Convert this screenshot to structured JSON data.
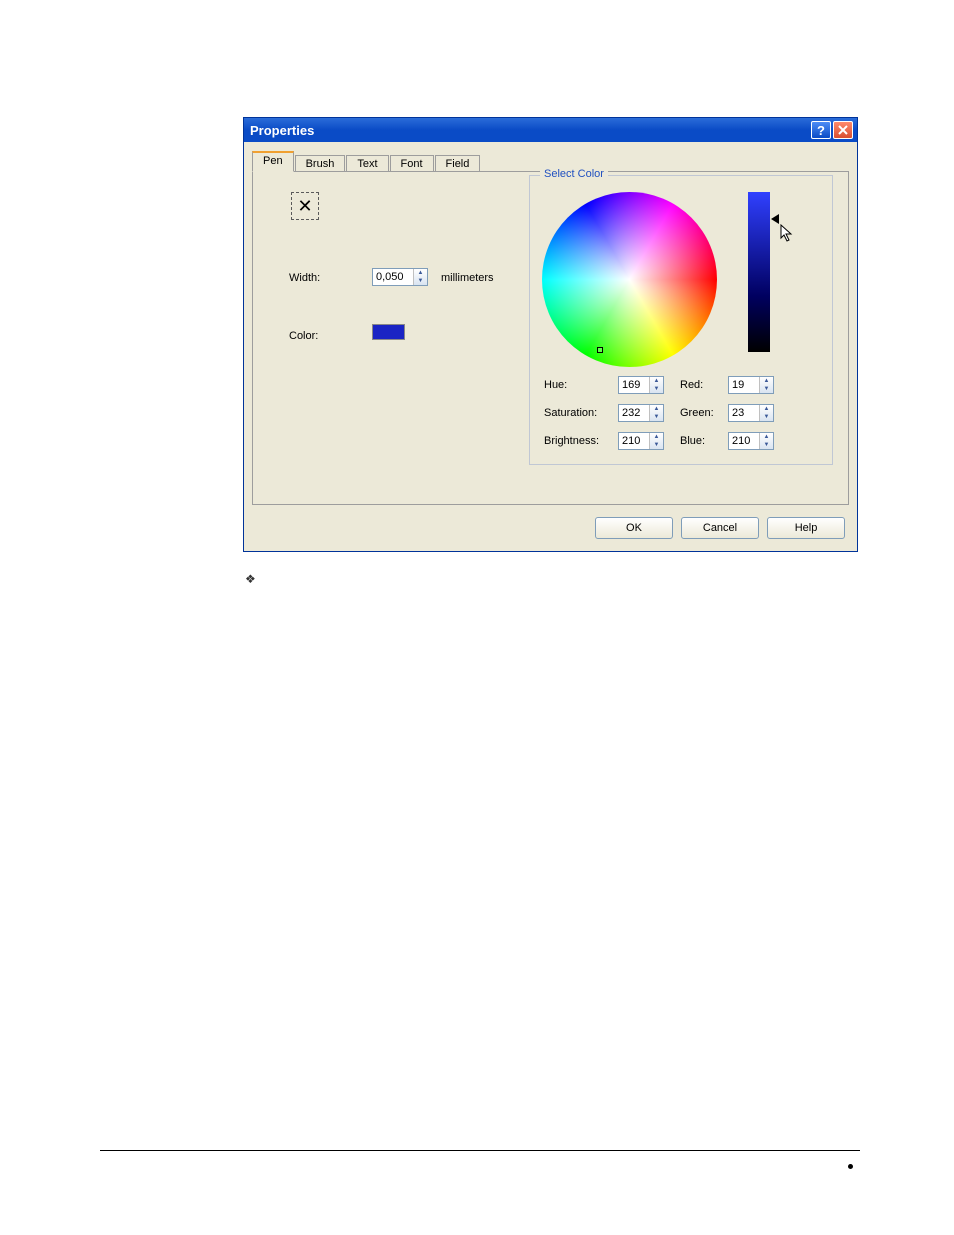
{
  "dialog": {
    "title": "Properties"
  },
  "tabs": [
    "Pen",
    "Brush",
    "Text",
    "Font",
    "Field"
  ],
  "icon_button_glyph": "✕",
  "labels": {
    "width": "Width:",
    "color": "Color:",
    "unit": "millimeters",
    "select_color": "Select Color",
    "hue": "Hue:",
    "saturation": "Saturation:",
    "brightness": "Brightness:",
    "red": "Red:",
    "green": "Green:",
    "blue": "Blue:"
  },
  "values": {
    "width": "0,050",
    "hue": "169",
    "saturation": "232",
    "brightness": "210",
    "red": "19",
    "green": "23",
    "blue": "210",
    "current_color": "#1a24c4"
  },
  "buttons": {
    "ok": "OK",
    "cancel": "Cancel",
    "help": "Help"
  }
}
